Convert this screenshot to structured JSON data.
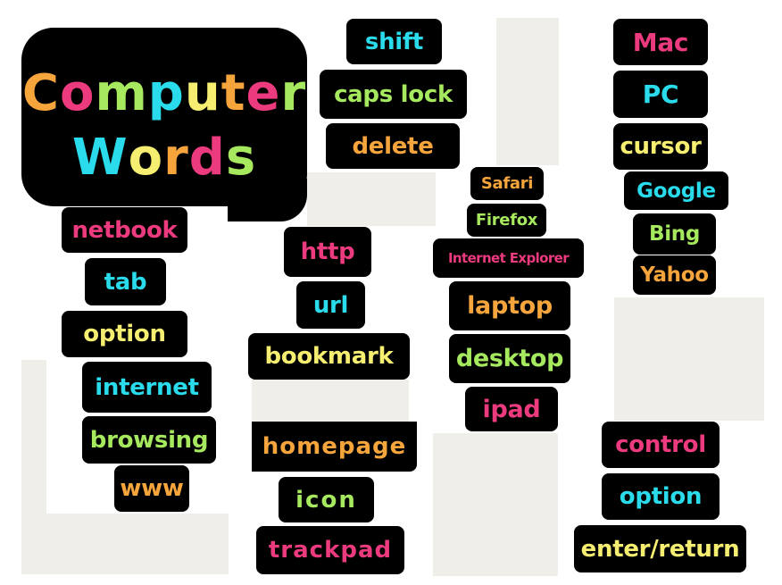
{
  "title": {
    "line1": [
      {
        "ch": "C",
        "color": "orange"
      },
      {
        "ch": "o",
        "color": "pink"
      },
      {
        "ch": "m",
        "color": "green"
      },
      {
        "ch": "p",
        "color": "cyan"
      },
      {
        "ch": "u",
        "color": "yellow"
      },
      {
        "ch": "t",
        "color": "orange"
      },
      {
        "ch": "e",
        "color": "pink"
      },
      {
        "ch": "r",
        "color": "green"
      }
    ],
    "line2": [
      {
        "ch": "W",
        "color": "cyan"
      },
      {
        "ch": "o",
        "color": "yellow"
      },
      {
        "ch": "r",
        "color": "orange"
      },
      {
        "ch": "d",
        "color": "pink"
      },
      {
        "ch": "s",
        "color": "green"
      }
    ]
  },
  "palette": {
    "orange": "#f5a53c",
    "pink": "#ec3a7e",
    "green": "#a6e85e",
    "cyan": "#2adbeb",
    "yellow": "#f5ee70",
    "tile_bg": "#000000",
    "page_bg": "#ffffff",
    "panel_bg": "#efeee9"
  },
  "words": {
    "shift": {
      "label": "shift",
      "color": "cyan"
    },
    "caps_lock": {
      "label": "caps lock",
      "color": "green"
    },
    "delete": {
      "label": "delete",
      "color": "orange"
    },
    "mac": {
      "label": "Mac",
      "color": "pink"
    },
    "pc": {
      "label": "PC",
      "color": "cyan"
    },
    "cursor": {
      "label": "cursor",
      "color": "yellow"
    },
    "google": {
      "label": "Google",
      "color": "cyan"
    },
    "bing": {
      "label": "Bing",
      "color": "green"
    },
    "yahoo": {
      "label": "Yahoo",
      "color": "orange"
    },
    "safari": {
      "label": "Safari",
      "color": "orange"
    },
    "firefox": {
      "label": "Firefox",
      "color": "green"
    },
    "internet_explorer": {
      "label": "Internet Explorer",
      "color": "pink"
    },
    "laptop": {
      "label": "laptop",
      "color": "orange"
    },
    "desktop": {
      "label": "desktop",
      "color": "green"
    },
    "ipad": {
      "label": "ipad",
      "color": "pink"
    },
    "netbook": {
      "label": "netbook",
      "color": "pink"
    },
    "tab": {
      "label": "tab",
      "color": "cyan"
    },
    "option_left": {
      "label": "option",
      "color": "yellow"
    },
    "internet": {
      "label": "internet",
      "color": "cyan"
    },
    "browsing": {
      "label": "browsing",
      "color": "green"
    },
    "www": {
      "label": "www",
      "color": "orange"
    },
    "http": {
      "label": "http",
      "color": "pink"
    },
    "url": {
      "label": "url",
      "color": "cyan"
    },
    "bookmark": {
      "label": "bookmark",
      "color": "yellow"
    },
    "homepage": {
      "label": "homepage",
      "color": "orange"
    },
    "icon": {
      "label": "icon",
      "color": "green"
    },
    "trackpad": {
      "label": "trackpad",
      "color": "pink"
    },
    "control": {
      "label": "control",
      "color": "pink"
    },
    "option_right": {
      "label": "option",
      "color": "cyan"
    },
    "enter_return": {
      "label": "enter/return",
      "color": "yellow"
    }
  }
}
